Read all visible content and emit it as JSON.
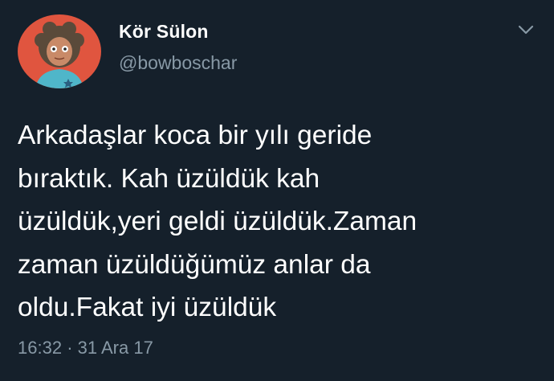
{
  "author": {
    "display_name": "Kör Sülon",
    "handle": "@bowboschar",
    "avatar_icon": "cartoon-avatar-icon"
  },
  "tweet": {
    "lines": [
      "Arkadaşlar koca bir yılı geride",
      "bıraktık. Kah üzüldük kah",
      "üzüldük,yeri geldi üzüldük.Zaman",
      "zaman üzüldüğümüz anlar da",
      "oldu.Fakat iyi üzüldük"
    ],
    "time": "16:32",
    "separator": "·",
    "date": "31 Ara 17"
  },
  "icons": {
    "menu": "chevron-down-icon"
  },
  "colors": {
    "background": "#15202b",
    "primary_text": "#ffffff",
    "secondary_text": "#8899a6",
    "avatar_bg": "#e0553f"
  }
}
